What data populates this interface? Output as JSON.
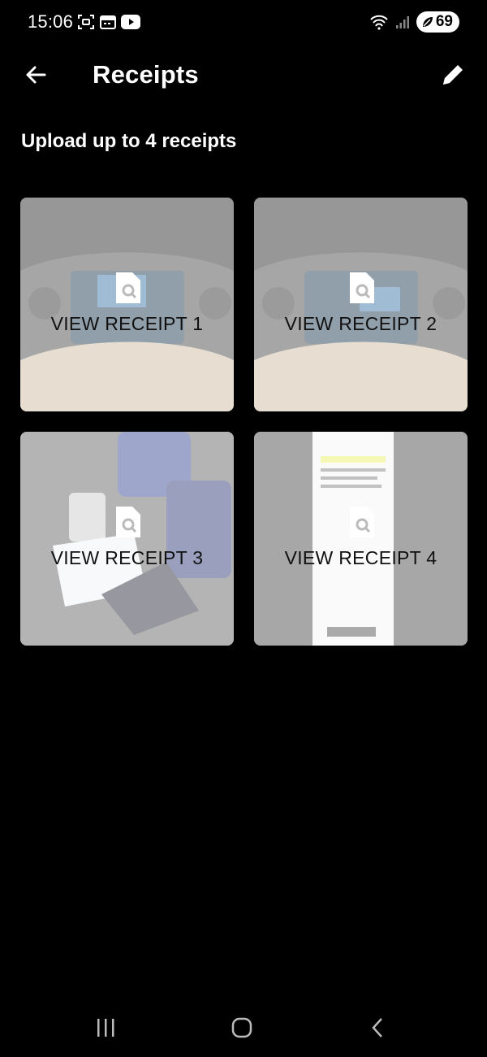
{
  "status_bar": {
    "time": "15:06",
    "battery": "69",
    "icons_left": [
      "screenshot-icon",
      "calendar-icon",
      "youtube-icon"
    ],
    "icons_right": [
      "wifi-icon",
      "signal-icon",
      "battery-icon"
    ]
  },
  "app_bar": {
    "title": "Receipts",
    "back_icon": "arrow-left-icon",
    "edit_icon": "pencil-icon"
  },
  "subtitle": "Upload up to 4 receipts",
  "receipts": [
    {
      "label": "VIEW RECEIPT 1",
      "thumbnail": "car dashboard"
    },
    {
      "label": "VIEW RECEIPT 2",
      "thumbnail": "car dashboard"
    },
    {
      "label": "VIEW RECEIPT 3",
      "thumbnail": "oil and filter"
    },
    {
      "label": "VIEW RECEIPT 4",
      "thumbnail": "paper receipt"
    }
  ],
  "nav_bar": {
    "items": [
      "recent-apps-icon",
      "home-icon",
      "back-icon"
    ]
  },
  "colors": {
    "background": "#000000",
    "text": "#ffffff",
    "card_overlay": "#ffffff",
    "card_label": "#111111"
  }
}
